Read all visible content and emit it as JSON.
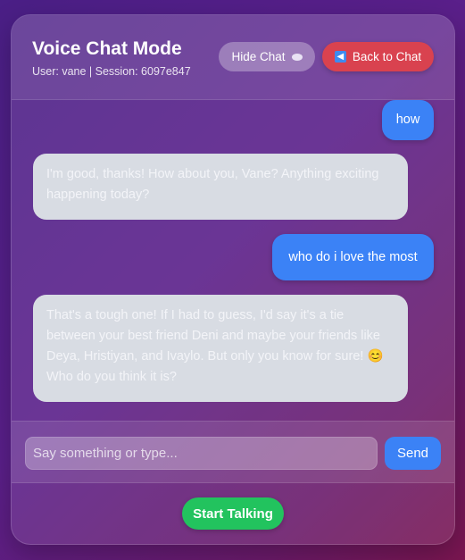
{
  "header": {
    "title": "Voice Chat Mode",
    "subtitle": "User: vane | Session: 6097e847",
    "hide_chat_label": "Hide Chat",
    "hide_chat_icon": "speech-bubble-icon",
    "back_label": "Back to Chat",
    "back_icon": "left-arrow-icon"
  },
  "messages": [
    {
      "role": "user",
      "text": "how"
    },
    {
      "role": "assistant",
      "text": "I'm good, thanks! How about you, Vane? Anything exciting happening today?"
    },
    {
      "role": "user",
      "text": "who do i love the most"
    },
    {
      "role": "assistant",
      "text": "That's a tough one! If I had to guess, I'd say it's a tie between your best friend Deni and maybe your friends like Deya, Hristiyan, and Ivaylo. But only you know for sure! 😊 Who do you think it is?"
    }
  ],
  "composer": {
    "placeholder": "Say something or type...",
    "value": "",
    "send_label": "Send"
  },
  "start_label": "Start Talking",
  "colors": {
    "user_bubble": "#3b82f6",
    "assistant_bubble": "#d8dce3",
    "back_button": "#d9424f",
    "start_button": "#22c35e"
  }
}
